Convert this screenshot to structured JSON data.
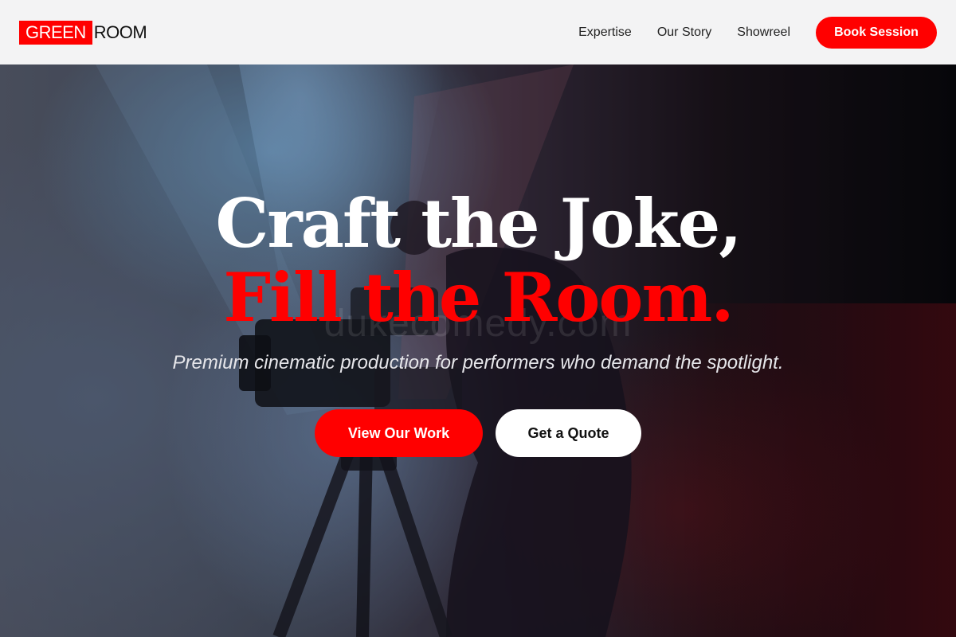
{
  "brand": {
    "logo_part1": "GREEN",
    "logo_part2": "ROOM",
    "accent_color": "#ff0000"
  },
  "nav": {
    "links": [
      "Expertise",
      "Our Story",
      "Showreel"
    ],
    "cta_label": "Book Session"
  },
  "hero": {
    "headline_line1": "Craft the Joke,",
    "headline_line2": "Fill the Room.",
    "watermark": "dukecomedy.com",
    "subline": "Premium cinematic production for performers who demand the spotlight.",
    "primary_cta": "View Our Work",
    "secondary_cta": "Get a Quote"
  }
}
